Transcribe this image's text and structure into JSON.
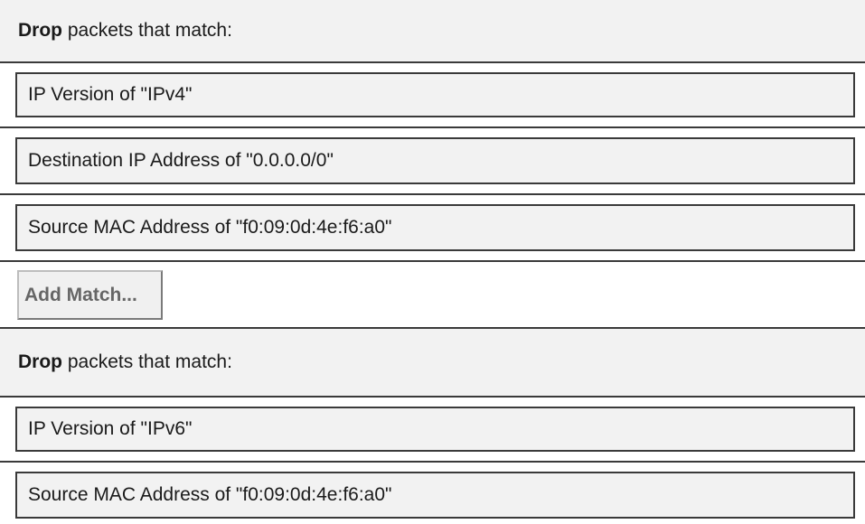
{
  "rules": [
    {
      "action": "Drop",
      "header_suffix": " packets that match:",
      "matches": [
        "IP Version of \"IPv4\"",
        "Destination IP Address of \"0.0.0.0/0\"",
        "Source MAC Address of \"f0:09:0d:4e:f6:a0\""
      ],
      "add_match_label": "Add Match..."
    },
    {
      "action": "Drop",
      "header_suffix": " packets that match:",
      "matches": [
        "IP Version of \"IPv6\"",
        "Source MAC Address of \"f0:09:0d:4e:f6:a0\""
      ]
    }
  ]
}
